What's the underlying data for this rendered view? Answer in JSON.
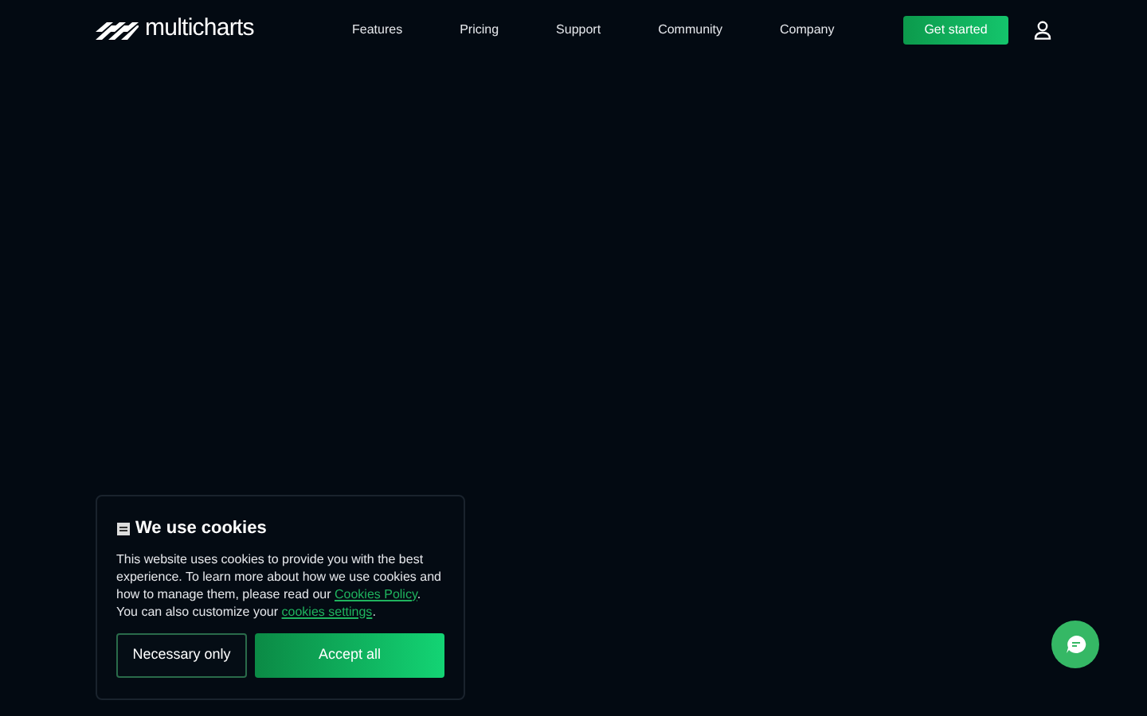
{
  "header": {
    "logo": "multicharts",
    "nav": [
      "Features",
      "Pricing",
      "Support",
      "Community",
      "Company"
    ],
    "cta": "Get started"
  },
  "cookie_banner": {
    "title": "We use cookies",
    "text_parts": [
      {
        "kind": "text",
        "text": "This website uses cookies to provide you with the best experience. To learn more about how we use cookies and how to manage them, please read our "
      },
      {
        "kind": "link",
        "text": "Cookies Policy"
      },
      {
        "kind": "text",
        "text": ". You can also customize your "
      },
      {
        "kind": "link",
        "text": "cookies settings"
      },
      {
        "kind": "text",
        "text": "."
      }
    ],
    "buttons": [
      {
        "label": "Necessary only",
        "kind": "outline"
      },
      {
        "label": "Accept all",
        "kind": "primary"
      }
    ]
  }
}
